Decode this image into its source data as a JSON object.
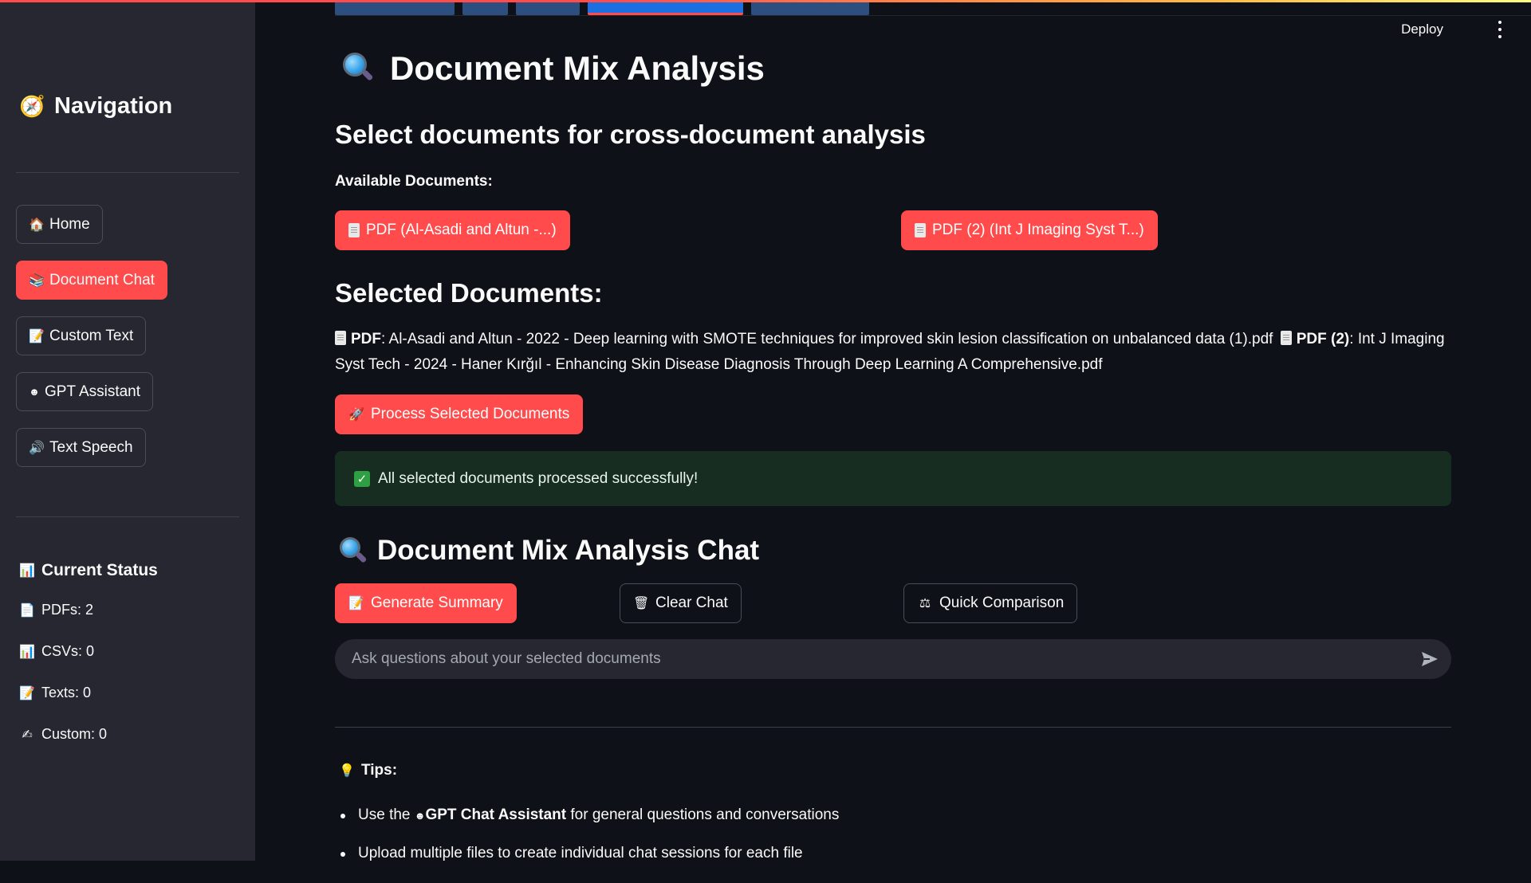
{
  "header": {
    "deploy_label": "Deploy"
  },
  "sidebar": {
    "title": "Navigation",
    "buttons": [
      {
        "label": "Home",
        "icon": "house-icon"
      },
      {
        "label": "Document Chat",
        "icon": "books-icon",
        "active": true
      },
      {
        "label": "Custom Text",
        "icon": "memo-icon"
      },
      {
        "label": "GPT Assistant",
        "icon": "robot-icon"
      },
      {
        "label": "Text Speech",
        "icon": "speaker-icon"
      }
    ],
    "status": {
      "title": "Current Status",
      "items": [
        {
          "label": "PDFs: 2",
          "icon": "page-icon"
        },
        {
          "label": "CSVs: 0",
          "icon": "bar-chart-icon"
        },
        {
          "label": "Texts: 0",
          "icon": "memo-icon"
        },
        {
          "label": "Custom: 0",
          "icon": "writing-hand-icon"
        }
      ]
    }
  },
  "main": {
    "title": "Document Mix Analysis",
    "subtitle": "Select documents for cross-document analysis",
    "available_label": "Available Documents:",
    "available_docs": [
      "PDF (Al-Asadi and Altun -...)",
      "PDF (2) (Int J Imaging Syst T...)"
    ],
    "selected_heading": "Selected Documents:",
    "selected": [
      {
        "type": "PDF",
        "name": "Al-Asadi and Altun - 2022 - Deep learning with SMOTE techniques for improved skin lesion classification on unbalanced data (1).pdf"
      },
      {
        "type": "PDF (2)",
        "name": "Int J Imaging Syst Tech - 2024 - Haner Kırğıl - Enhancing Skin Disease Diagnosis Through Deep Learning A Comprehensive.pdf"
      }
    ],
    "process_button": "Process Selected Documents",
    "success_message": "All selected documents processed successfully!",
    "chat_title": "Document Mix Analysis Chat",
    "chat_buttons": {
      "summary": "Generate Summary",
      "clear": "Clear Chat",
      "compare": "Quick Comparison"
    },
    "chat_placeholder": "Ask questions about your selected documents",
    "tips_label": "Tips:",
    "tips": [
      {
        "prefix": "Use the ",
        "bold": "GPT Chat Assistant",
        "suffix": " for general questions and conversations"
      },
      {
        "prefix": "Upload multiple files to create individual chat sessions for each file",
        "bold": "",
        "suffix": ""
      }
    ]
  },
  "colors": {
    "primary": "#ff4b4b",
    "background": "#0e1117",
    "sidebar": "#262730",
    "success_bg": "#172d22"
  }
}
